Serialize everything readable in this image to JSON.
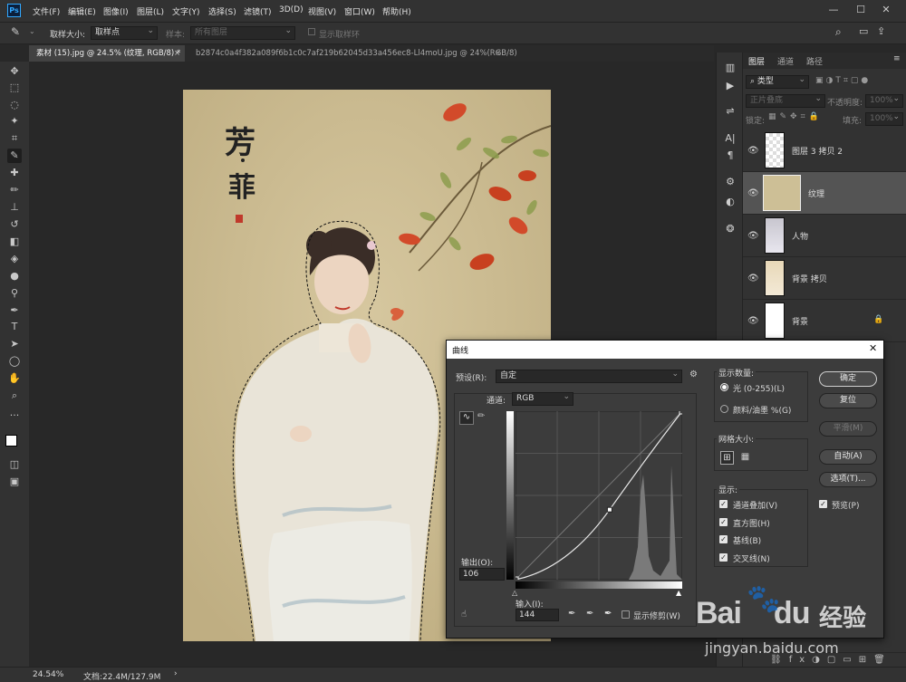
{
  "app": {
    "logo": "Ps"
  },
  "menu": [
    "文件(F)",
    "编辑(E)",
    "图像(I)",
    "图层(L)",
    "文字(Y)",
    "选择(S)",
    "滤镜(T)",
    "3D(D)",
    "视图(V)",
    "窗口(W)",
    "帮助(H)"
  ],
  "window_controls": {
    "minimize": "—",
    "maximize": "☐",
    "close": "✕"
  },
  "options_bar": {
    "sample_size_label": "取样大小:",
    "sample_size_value": "取样点",
    "sample_label": "样本:",
    "sample_value": "所有图层",
    "show_ring_label": "显示取样环"
  },
  "tabs": [
    {
      "label": "素材 (15).jpg @ 24.5% (纹理, RGB/8) *",
      "close": "×"
    },
    {
      "label": "b2874c0a4f382a089f6b1c0c7af219b62045d33a456ec8-Ll4moU.jpg @ 24%(RGB/8)",
      "close": "×"
    }
  ],
  "document": {
    "calligraphy_line1": "芳",
    "calligraphy_line2": "菲"
  },
  "status": {
    "zoom": "24.54%",
    "doc_size": "文档:22.4M/127.9M",
    "arrow": "›"
  },
  "layers_panel": {
    "tabs": [
      "图层",
      "通道",
      "路径"
    ],
    "filter_placeholder": "类型",
    "blend_mode": "正片叠底",
    "opacity_label": "不透明度:",
    "opacity_value": "100%",
    "lock_label": "锁定:",
    "fill_label": "填充:",
    "fill_value": "100%",
    "layers": [
      {
        "name": "图层 3 拷贝 2",
        "selected": false,
        "locked": false
      },
      {
        "name": "纹理",
        "selected": true,
        "locked": false
      },
      {
        "name": "人物",
        "selected": false,
        "locked": false
      },
      {
        "name": "背景 拷贝",
        "selected": false,
        "locked": false
      },
      {
        "name": "背景",
        "selected": false,
        "locked": true
      }
    ]
  },
  "curves_dialog": {
    "title": "曲线",
    "preset_label": "预设(R):",
    "preset_value": "自定",
    "channel_label": "通道:",
    "channel_value": "RGB",
    "output_label": "输出(O):",
    "output_value": "106",
    "input_label": "输入(I):",
    "input_value": "144",
    "show_clipping_label": "显示修剪(W)",
    "show_clipping_checked": false,
    "display_amount_title": "显示数量:",
    "light_option": "光 (0-255)(L)",
    "pigment_option": "颜料/油墨 %(G)",
    "light_selected": true,
    "grid_size_title": "网格大小:",
    "show_title": "显示:",
    "show_options": [
      {
        "label": "通道叠加(V)",
        "checked": true
      },
      {
        "label": "直方图(H)",
        "checked": true
      },
      {
        "label": "基线(B)",
        "checked": true
      },
      {
        "label": "交叉线(N)",
        "checked": true
      }
    ],
    "preview_label": "预览(P)",
    "preview_checked": true,
    "buttons": {
      "ok": "确定",
      "reset": "复位",
      "smooth": "平滑(M)",
      "auto": "自动(A)",
      "options": "选项(T)..."
    },
    "curve": {
      "input": 144,
      "output": 106
    }
  },
  "watermark": {
    "brand": "Bai",
    "brand2": "du",
    "cn": "经验",
    "url": "jingyan.baidu.com"
  }
}
